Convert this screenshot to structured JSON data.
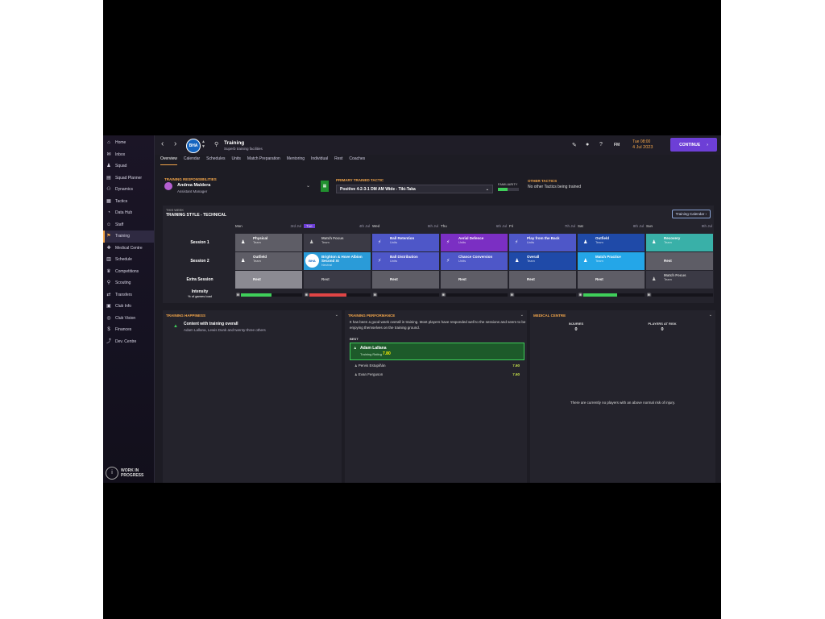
{
  "sidebar": {
    "items": [
      {
        "label": "Home",
        "icon": "home-icon"
      },
      {
        "label": "Inbox",
        "icon": "inbox-icon"
      },
      {
        "label": "Squad",
        "icon": "squad-icon"
      },
      {
        "label": "Squad Planner",
        "icon": "planner-icon"
      },
      {
        "label": "Dynamics",
        "icon": "dynamics-icon"
      },
      {
        "label": "Tactics",
        "icon": "tactics-icon"
      },
      {
        "label": "Data Hub",
        "icon": "data-hub-icon"
      },
      {
        "label": "Staff",
        "icon": "staff-icon"
      },
      {
        "label": "Training",
        "icon": "training-icon"
      },
      {
        "label": "Medical Centre",
        "icon": "medical-icon"
      },
      {
        "label": "Schedule",
        "icon": "schedule-icon"
      },
      {
        "label": "Competitions",
        "icon": "trophy-icon"
      },
      {
        "label": "Scouting",
        "icon": "scouting-icon"
      },
      {
        "label": "Transfers",
        "icon": "transfers-icon"
      },
      {
        "label": "Club Info",
        "icon": "club-info-icon"
      },
      {
        "label": "Club Vision",
        "icon": "club-vision-icon"
      },
      {
        "label": "Finances",
        "icon": "finances-icon"
      },
      {
        "label": "Dev. Centre",
        "icon": "dev-centre-icon"
      }
    ],
    "active_index": 8,
    "wip_line1": "WORK IN",
    "wip_line2": "PROGRESS"
  },
  "topbar": {
    "club_badge": "BHA",
    "title": "Training",
    "subtitle": "Superb training facilities",
    "fm_label": "FM",
    "date_day": "Tue 08:00",
    "date_date": "4 Jul 2023",
    "continue_label": "CONTINUE"
  },
  "tabs": [
    "Overview",
    "Calendar",
    "Schedules",
    "Units",
    "Match Preparation",
    "Mentoring",
    "Individual",
    "Rest",
    "Coaches"
  ],
  "responsibility": {
    "label": "TRAINING RESPONSIBILITIES",
    "name": "Andrea Maldera",
    "role": "Assistant Manager"
  },
  "tactic": {
    "label": "PRIMARY TRAINED TACTIC",
    "value": "Positive 4-2-3-1 DM AM Wide - Tiki-Taka",
    "familiarity_label": "FAMILIARITY",
    "familiarity": 0.45
  },
  "other_tactics": {
    "label": "OTHER TACTICS",
    "text": "No other Tactics being trained"
  },
  "schedule": {
    "week_label": "THIS WEEK",
    "style_label": "TRAINING STYLE - TECHNICAL",
    "calendar_button": "Training Calendar",
    "days": [
      {
        "name": "Mon",
        "date": "3rd Jul"
      },
      {
        "name": "Tue",
        "date": "4th Jul"
      },
      {
        "name": "Wed",
        "date": "5th Jul"
      },
      {
        "name": "Thu",
        "date": "6th Jul"
      },
      {
        "name": "Fri",
        "date": "7th Jul"
      },
      {
        "name": "Sat",
        "date": "8th Jul"
      },
      {
        "name": "Sun",
        "date": "9th Jul"
      }
    ],
    "active_day": 1,
    "rows": [
      {
        "label": "Session 1",
        "cells": [
          {
            "title": "Physical",
            "sub": "Team",
            "color": "c-grey"
          },
          {
            "title": "Match Focus",
            "sub": "Team",
            "color": "c-dgrey"
          },
          {
            "title": "Ball Retention",
            "sub": "Units",
            "color": "c-purple"
          },
          {
            "title": "Aerial Defence",
            "sub": "Units",
            "color": "c-violet"
          },
          {
            "title": "Play from the Back",
            "sub": "Units",
            "color": "c-purple"
          },
          {
            "title": "Outfield",
            "sub": "Team",
            "color": "c-navy"
          },
          {
            "title": "Recovery",
            "sub": "Team",
            "color": "c-teal"
          }
        ]
      },
      {
        "label": "Session 2",
        "cells": [
          {
            "title": "Outfield",
            "sub": "Team",
            "color": "c-grey"
          },
          {
            "title": "Brighton & Hove Albion Second XI",
            "sub": "Neutral",
            "color": "c-brighton"
          },
          {
            "title": "Ball Distribution",
            "sub": "Units",
            "color": "c-purple"
          },
          {
            "title": "Chance Conversion",
            "sub": "Units",
            "color": "c-purple"
          },
          {
            "title": "Overall",
            "sub": "Team",
            "color": "c-navy"
          },
          {
            "title": "Match Practice",
            "sub": "Team",
            "color": "c-cyan"
          },
          {
            "title": "Rest",
            "sub": "",
            "color": "c-rest"
          }
        ]
      },
      {
        "label": "Extra Session",
        "cells": [
          {
            "title": "Rest",
            "sub": "",
            "color": "c-lgrey"
          },
          {
            "title": "Rest",
            "sub": "",
            "color": "c-dgrey"
          },
          {
            "title": "Rest",
            "sub": "",
            "color": "c-rest"
          },
          {
            "title": "Rest",
            "sub": "",
            "color": "c-rest"
          },
          {
            "title": "Rest",
            "sub": "",
            "color": "c-rest"
          },
          {
            "title": "Rest",
            "sub": "",
            "color": "c-rest"
          },
          {
            "title": "Match Focus",
            "sub": "Team",
            "color": "c-dgrey"
          }
        ]
      }
    ],
    "intensity_label": "Intensity",
    "intensity_sub": "% of games load",
    "intensity": [
      {
        "value": 0.5,
        "color": "#3fcf5a"
      },
      {
        "value": 0.6,
        "color": "#e04545"
      },
      {
        "value": 0.0,
        "color": "#3fcf5a"
      },
      {
        "value": 0.0,
        "color": "#3fcf5a"
      },
      {
        "value": 0.0,
        "color": "#3fcf5a"
      },
      {
        "value": 0.55,
        "color": "#3fcf5a"
      },
      {
        "value": 0.0,
        "color": "#3fcf5a"
      }
    ]
  },
  "happiness": {
    "label": "TRAINING HAPPINESS",
    "title": "Content with training overall",
    "players": "Adam Lallana, Lewis Dunk and twenty-three others"
  },
  "performance": {
    "label": "TRAINING PERFORMANCE",
    "description": "It has been a good week overall in training. Most players have responded well to the sessions and seem to be enjoying themselves on the training ground.",
    "best_label": "BEST",
    "best_name": "Adam Lallana",
    "best_rating_label": "Training Rating",
    "best_rating": "7.80",
    "others": [
      {
        "name": "Pervis Estupiñán",
        "rating": "7.60"
      },
      {
        "name": "Evan Ferguson",
        "rating": "7.60"
      }
    ]
  },
  "medical": {
    "label": "MEDICAL CENTRE",
    "injuries_label": "INJURIES",
    "injuries": "0",
    "risk_label": "PLAYERS AT RISK",
    "risk": "0",
    "empty_text": "There are currently no players with an above normal risk of injury."
  }
}
